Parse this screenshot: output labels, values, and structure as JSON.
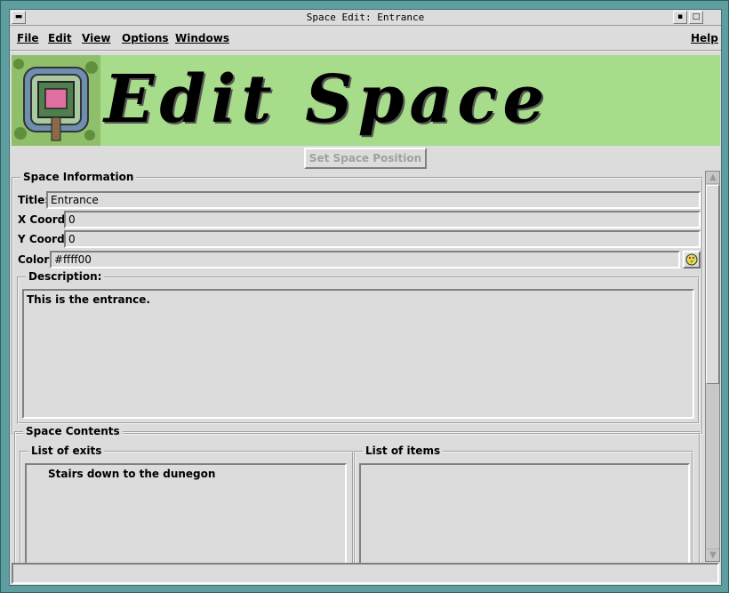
{
  "window": {
    "title": "Space Edit: Entrance"
  },
  "menubar": {
    "items": [
      "File",
      "Edit",
      "View",
      "Options",
      "Windows"
    ],
    "help": "Help"
  },
  "banner": {
    "text": "Edit Space"
  },
  "toolbar": {
    "set_position_label": "Set Space Position"
  },
  "space_info": {
    "group_label": "Space Information",
    "title_label": "Title:",
    "title_value": "Entrance",
    "x_label": "X Coord:",
    "x_value": "0",
    "y_label": "Y Coord:",
    "y_value": "0",
    "color_label": "Color:",
    "color_value": "#ffff00",
    "description_label": "Description:",
    "description_value": "This is the entrance."
  },
  "space_contents": {
    "group_label": "Space Contents",
    "exits_label": "List of exits",
    "exits": [
      "Stairs down to the dunegon"
    ],
    "items_label": "List of items",
    "items": []
  },
  "colors": {
    "frame": "#5f9ea0",
    "background": "#dcdcdc",
    "banner": "#a6dc8a"
  },
  "icons": {
    "window_menu": "window-menu-icon",
    "minimize": "minimize-icon",
    "maximize": "maximize-icon",
    "color_picker": "palette-icon"
  }
}
